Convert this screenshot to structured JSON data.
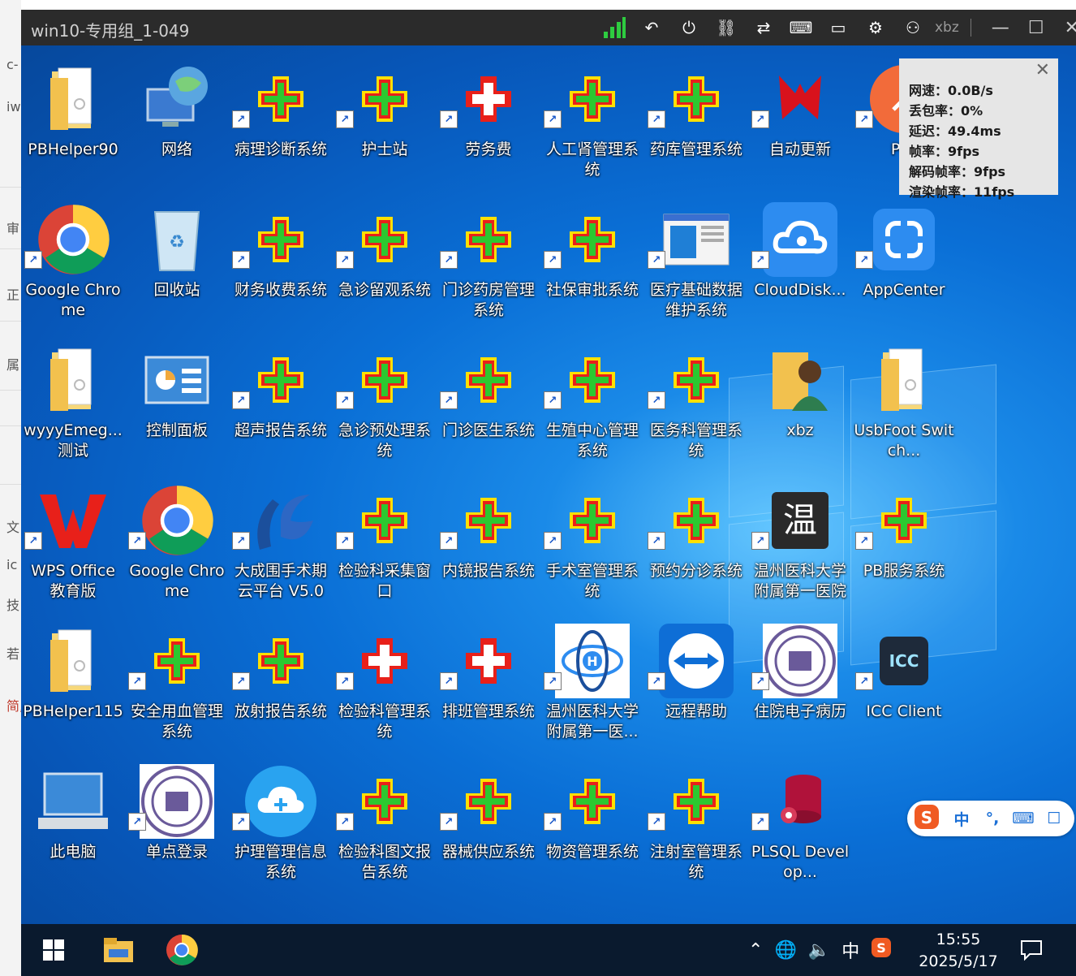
{
  "host": {
    "fragments": [
      "c-",
      "iw",
      "审",
      "正",
      "属",
      "文",
      "ic",
      "技",
      "若",
      "简,"
    ]
  },
  "window": {
    "title": "win10-专用组_1-049",
    "user": "xbz",
    "icons": [
      "signal-icon",
      "back-icon",
      "power-icon",
      "disconnect-icon",
      "switch-icon",
      "keyboard-icon",
      "window-icon",
      "settings-icon",
      "user-icon"
    ]
  },
  "stats": {
    "lines": [
      "网速：0.0B/s",
      "丢包率：0%",
      "延迟：49.4ms",
      "帧率：9fps",
      "解码帧率：9fps",
      "渲染帧率：11fps"
    ],
    "close": "✕"
  },
  "desktop_icons": [
    {
      "label": "PBHelper90",
      "type": "folder",
      "shortcut": false
    },
    {
      "label": "网络",
      "type": "network",
      "shortcut": false
    },
    {
      "label": "病理诊断系统",
      "type": "his",
      "shortcut": true
    },
    {
      "label": "护士站",
      "type": "his",
      "shortcut": true
    },
    {
      "label": "劳务费",
      "type": "redcross",
      "shortcut": true
    },
    {
      "label": "人工肾管理系统",
      "type": "his",
      "shortcut": true
    },
    {
      "label": "药库管理系统",
      "type": "his",
      "shortcut": true
    },
    {
      "label": "自动更新",
      "type": "autoupdate",
      "shortcut": true
    },
    {
      "label": "Pos",
      "type": "postman",
      "shortcut": true
    },
    {
      "label": "Google Chrome",
      "type": "chrome",
      "shortcut": true
    },
    {
      "label": "回收站",
      "type": "recycle",
      "shortcut": false
    },
    {
      "label": "财务收费系统",
      "type": "his",
      "shortcut": true
    },
    {
      "label": "急诊留观系统",
      "type": "his",
      "shortcut": true
    },
    {
      "label": "门诊药房管理系统",
      "type": "his",
      "shortcut": true
    },
    {
      "label": "社保审批系统",
      "type": "his",
      "shortcut": true
    },
    {
      "label": "医疗基础数据维护系统",
      "type": "window",
      "shortcut": true
    },
    {
      "label": "CloudDisk...",
      "type": "clouddisk",
      "shortcut": true
    },
    {
      "label": "AppCenter",
      "type": "appcenter",
      "shortcut": true
    },
    {
      "label": "wyyyEmeg...测试",
      "type": "folder",
      "shortcut": false
    },
    {
      "label": "控制面板",
      "type": "controlpanel",
      "shortcut": false
    },
    {
      "label": "超声报告系统",
      "type": "his",
      "shortcut": true
    },
    {
      "label": "急诊预处理系统",
      "type": "his",
      "shortcut": true
    },
    {
      "label": "门诊医生系统",
      "type": "his",
      "shortcut": true
    },
    {
      "label": "生殖中心管理系统",
      "type": "his",
      "shortcut": true
    },
    {
      "label": "医务科管理系统",
      "type": "his",
      "shortcut": true
    },
    {
      "label": "xbz",
      "type": "userfolder",
      "shortcut": false
    },
    {
      "label": "UsbFoot Switch...",
      "type": "folder",
      "shortcut": false
    },
    {
      "label": "WPS Office 教育版",
      "type": "wps",
      "shortcut": true
    },
    {
      "label": "Google Chrome",
      "type": "chrome",
      "shortcut": true
    },
    {
      "label": "大成围手术期云平台 V5.0",
      "type": "dc",
      "shortcut": true
    },
    {
      "label": "检验科采集窗口",
      "type": "his",
      "shortcut": true
    },
    {
      "label": "内镜报告系统",
      "type": "his",
      "shortcut": true
    },
    {
      "label": "手术室管理系统",
      "type": "his",
      "shortcut": true
    },
    {
      "label": "预约分诊系统",
      "type": "his",
      "shortcut": true
    },
    {
      "label": "温州医科大学附属第一医院",
      "type": "wen",
      "shortcut": true,
      "glyph": "温"
    },
    {
      "label": "PB服务系统",
      "type": "his",
      "shortcut": true
    },
    {
      "label": "PBHelper115",
      "type": "folder",
      "shortcut": false
    },
    {
      "label": "安全用血管理系统",
      "type": "his",
      "shortcut": true
    },
    {
      "label": "放射报告系统",
      "type": "his",
      "shortcut": true
    },
    {
      "label": "检验科管理系统",
      "type": "redcross",
      "shortcut": true
    },
    {
      "label": "排班管理系统",
      "type": "redcross",
      "shortcut": true
    },
    {
      "label": "温州医科大学附属第一医...",
      "type": "hlogo",
      "shortcut": true
    },
    {
      "label": "远程帮助",
      "type": "teamviewer",
      "shortcut": true
    },
    {
      "label": "住院电子病历",
      "type": "seal",
      "shortcut": true
    },
    {
      "label": "ICC Client",
      "type": "icc",
      "shortcut": true,
      "glyph": "ICC"
    },
    {
      "label": "此电脑",
      "type": "computer",
      "shortcut": false
    },
    {
      "label": "单点登录",
      "type": "seal",
      "shortcut": true
    },
    {
      "label": "护理管理信息系统",
      "type": "cloud",
      "shortcut": true
    },
    {
      "label": "检验科图文报告系统",
      "type": "his",
      "shortcut": true
    },
    {
      "label": "器械供应系统",
      "type": "his",
      "shortcut": true
    },
    {
      "label": "物资管理系统",
      "type": "his",
      "shortcut": true
    },
    {
      "label": "注射室管理系统",
      "type": "his",
      "shortcut": true
    },
    {
      "label": "PLSQL Develop...",
      "type": "plsql",
      "shortcut": true
    }
  ],
  "ime": {
    "items": [
      "中",
      "°,",
      "⌨",
      "☐"
    ]
  },
  "taskbar": {
    "tray_lang": "中",
    "time": "15:55",
    "date": "2025/5/17"
  },
  "colors": {
    "titlebar": "#2b2b2b",
    "taskbar": "#0a1a2e",
    "his_green": "#2cc830",
    "his_red": "#e8201a",
    "his_yellow": "#ffe000"
  }
}
